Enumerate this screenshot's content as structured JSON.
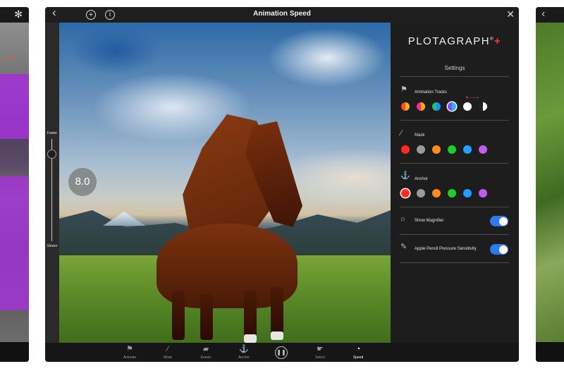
{
  "header": {
    "title": "Animation Speed"
  },
  "slider": {
    "top_label": "Faster",
    "bottom_label": "Slower",
    "value_display": "8.0"
  },
  "panel": {
    "logo_text": "PLOTAGRAPH",
    "logo_mark": "®",
    "logo_plus": "+",
    "settings_title": "Settings",
    "animation_tracks": {
      "label": "Animation Tracks",
      "colors": [
        "#ff4b1f / #f2b01e",
        "#ff2b8a / #ffb000",
        "#18c27a / #1b8cff",
        "#8a4bff / #2bb3ff",
        "#ffffff",
        "#222222 / #ffffff"
      ]
    },
    "mask": {
      "label": "Mask",
      "colors": [
        "#ff2d1f",
        "#9a9a9a",
        "#ff8c1a",
        "#1fce2a",
        "#1ea1ff",
        "#c05cf0"
      ]
    },
    "anchor": {
      "label": "Anchor",
      "colors": [
        "#ff2d1f",
        "#9a9a9a",
        "#ff8c1a",
        "#1fce2a",
        "#1ea1ff",
        "#c05cf0"
      ]
    },
    "show_magnifier": {
      "label": "Show Magnifier",
      "on": true
    },
    "pencil_pressure": {
      "label": "Apple Pencil Pressure Sensitivity",
      "on": true
    }
  },
  "toolbar": {
    "items": [
      {
        "label": "Animate",
        "icon": "animate-icon"
      },
      {
        "label": "Mask",
        "icon": "brush-icon"
      },
      {
        "label": "Eraser",
        "icon": "eraser-icon"
      },
      {
        "label": "Anchor",
        "icon": "anchor-icon"
      },
      {
        "label": "Select",
        "icon": "hand-icon"
      },
      {
        "label": "Speed",
        "icon": "speed-icon"
      }
    ]
  },
  "colors": {
    "accent_toggle": "#2d7bf0",
    "logo_plus": "#ff3b3b",
    "left_screen_overlay": "#a234d6"
  }
}
